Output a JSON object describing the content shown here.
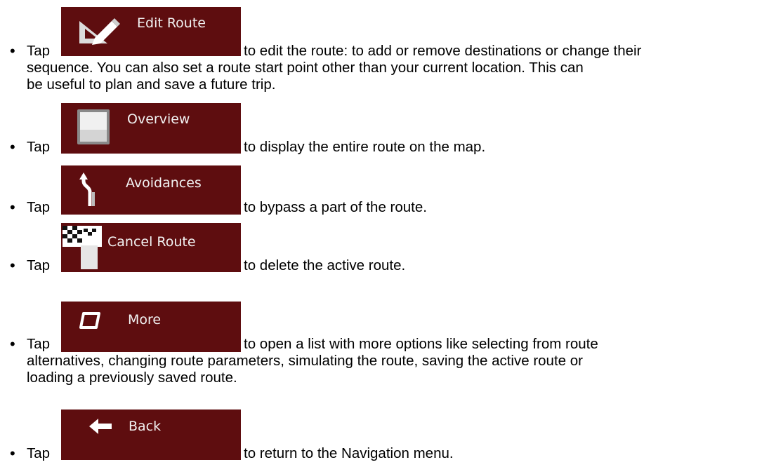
{
  "items": [
    {
      "tap": "Tap",
      "button_label": "Edit Route",
      "icon": "edit-route-icon",
      "text_lines": [
        "to edit the route: to add or remove destinations or change their",
        "sequence. You can also set a route start point other than your current location. This can",
        "be useful to plan and save a future trip."
      ]
    },
    {
      "tap": "Tap",
      "button_label": "Overview",
      "icon": "overview-icon",
      "text_lines": [
        "to display the entire route on the map."
      ]
    },
    {
      "tap": "Tap",
      "button_label": "Avoidances",
      "icon": "avoidances-icon",
      "text_lines": [
        "to bypass a part of the route."
      ]
    },
    {
      "tap": "Tap",
      "button_label": "Cancel Route",
      "icon": "checkered-flag-icon",
      "text_lines": [
        "to delete the active route."
      ]
    },
    {
      "tap": "Tap",
      "button_label": "More",
      "icon": "more-icon",
      "text_lines": [
        "to open a list with more options like selecting from route",
        "alternatives, changing route parameters, simulating the route, saving the active route or",
        "loading a previously saved route."
      ]
    },
    {
      "tap": "Tap",
      "button_label": "Back",
      "icon": "back-arrow-icon",
      "text_lines": [
        "to return to the Navigation menu."
      ]
    }
  ],
  "colors": {
    "button_bg": "#5e0d0f",
    "button_text": "#f2f2f2"
  }
}
